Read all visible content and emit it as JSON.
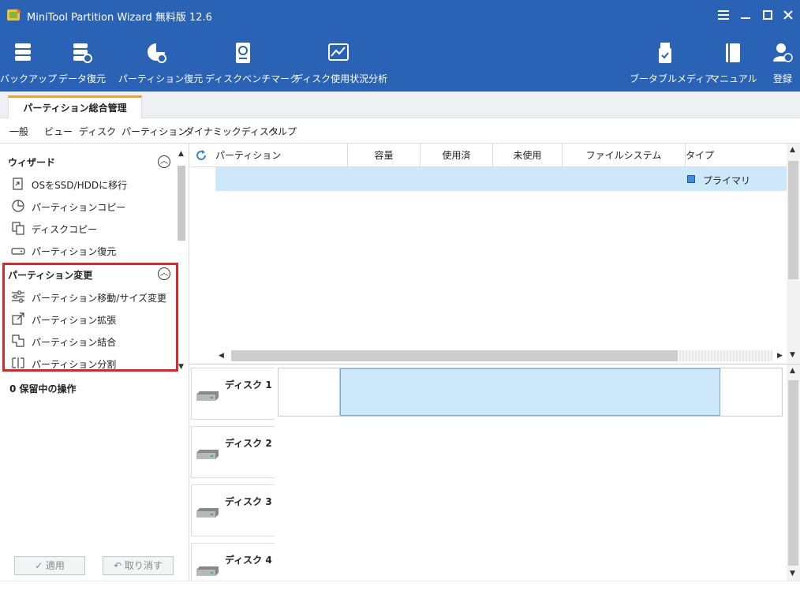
{
  "window": {
    "title": "MiniTool Partition Wizard 無料版 12.6",
    "controls": [
      "menu-icon",
      "minimize-icon",
      "maximize-icon",
      "close-icon"
    ]
  },
  "toolbar": {
    "left": [
      {
        "label": "バックアップ",
        "icon": "backup-icon"
      },
      {
        "label": "データ復元",
        "icon": "data-recovery-icon"
      },
      {
        "label": "パーティション復元",
        "icon": "partition-recovery-icon"
      },
      {
        "label": "ディスクベンチマーク",
        "icon": "disk-benchmark-icon"
      },
      {
        "label": "ディスク使用状況分析",
        "icon": "space-analyzer-icon"
      }
    ],
    "right": [
      {
        "label": "ブータブルメディア",
        "icon": "bootable-media-icon"
      },
      {
        "label": "マニュアル",
        "icon": "manual-icon"
      },
      {
        "label": "登録",
        "icon": "register-icon"
      }
    ]
  },
  "tabs": [
    {
      "label": "パーティション総合管理"
    }
  ],
  "menubar": [
    "一般",
    "ビュー",
    "ディスク",
    "パーティション",
    "ダイナミックディスク",
    "ヘルプ"
  ],
  "sidebar": {
    "wizard_title": "ウィザード",
    "wizard_items": [
      {
        "label": "OSをSSD/HDDに移行",
        "icon": "migrate-os-icon"
      },
      {
        "label": "パーティションコピー",
        "icon": "partition-copy-icon"
      },
      {
        "label": "ディスクコピー",
        "icon": "disk-copy-icon"
      },
      {
        "label": "パーティション復元",
        "icon": "partition-recovery-icon"
      }
    ],
    "change_title": "パーティション変更",
    "change_items": [
      {
        "label": "パーティション移動/サイズ変更",
        "icon": "move-resize-icon"
      },
      {
        "label": "パーティション拡張",
        "icon": "extend-icon"
      },
      {
        "label": "パーティション結合",
        "icon": "merge-icon"
      },
      {
        "label": "パーティション分割",
        "icon": "split-icon"
      }
    ],
    "pending": "0 保留中の操作",
    "apply_label": "✓ 適用",
    "undo_label": "↶ 取り消す"
  },
  "table": {
    "columns": [
      "パーティション",
      "容量",
      "使用済",
      "未使用",
      "ファイルシステム",
      "タイプ"
    ],
    "rows": [
      {
        "partition": "",
        "capacity": "",
        "used": "",
        "unused": "",
        "filesystem": "",
        "type": "プライマリ"
      }
    ]
  },
  "disks": [
    {
      "label": "ディスク 1"
    },
    {
      "label": "ディスク 2"
    },
    {
      "label": "ディスク 3"
    },
    {
      "label": "ディスク 4"
    }
  ],
  "colors": {
    "header_bg": "#2a63b5",
    "accent_tab": "#f0a030",
    "selection": "#cde8fb",
    "highlight_box": "#e0242b",
    "primary_swatch": "#3c8ddc"
  }
}
